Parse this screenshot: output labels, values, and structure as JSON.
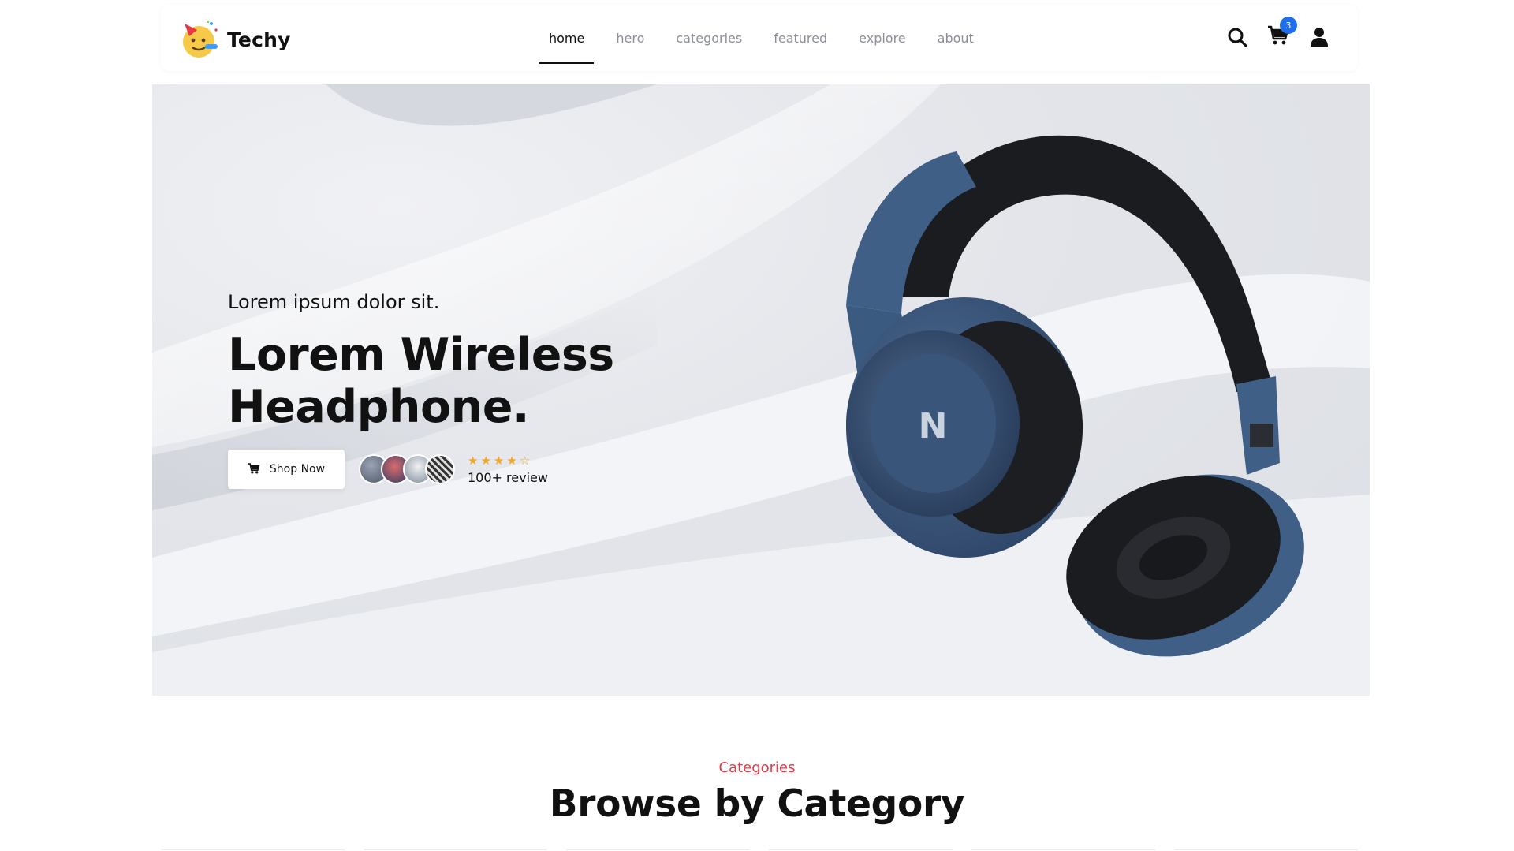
{
  "brand": {
    "name": "Techy",
    "logo_icon": "party-face-icon"
  },
  "nav": {
    "items": [
      {
        "label": "home",
        "active": true
      },
      {
        "label": "hero",
        "active": false
      },
      {
        "label": "categories",
        "active": false
      },
      {
        "label": "featured",
        "active": false
      },
      {
        "label": "explore",
        "active": false
      },
      {
        "label": "about",
        "active": false
      }
    ]
  },
  "header_icons": {
    "search": "search-icon",
    "cart": "cart-icon",
    "cart_count": "3",
    "user": "user-icon"
  },
  "hero": {
    "subtitle": "Lorem ipsum dolor sit.",
    "title_line1": "Lorem Wireless",
    "title_line2": "Headphone.",
    "cta_label": "Shop Now",
    "rating_stars": 4,
    "rating_max": 5,
    "review_text": "100+ review",
    "product_image": "blue-headphone-image"
  },
  "categories": {
    "eyebrow": "Categories",
    "title": "Browse by Category"
  },
  "colors": {
    "accent": "#1f6feb",
    "eyebrow": "#e63946",
    "star": "#f5a623",
    "headphone_blue": "#3f5f86"
  }
}
